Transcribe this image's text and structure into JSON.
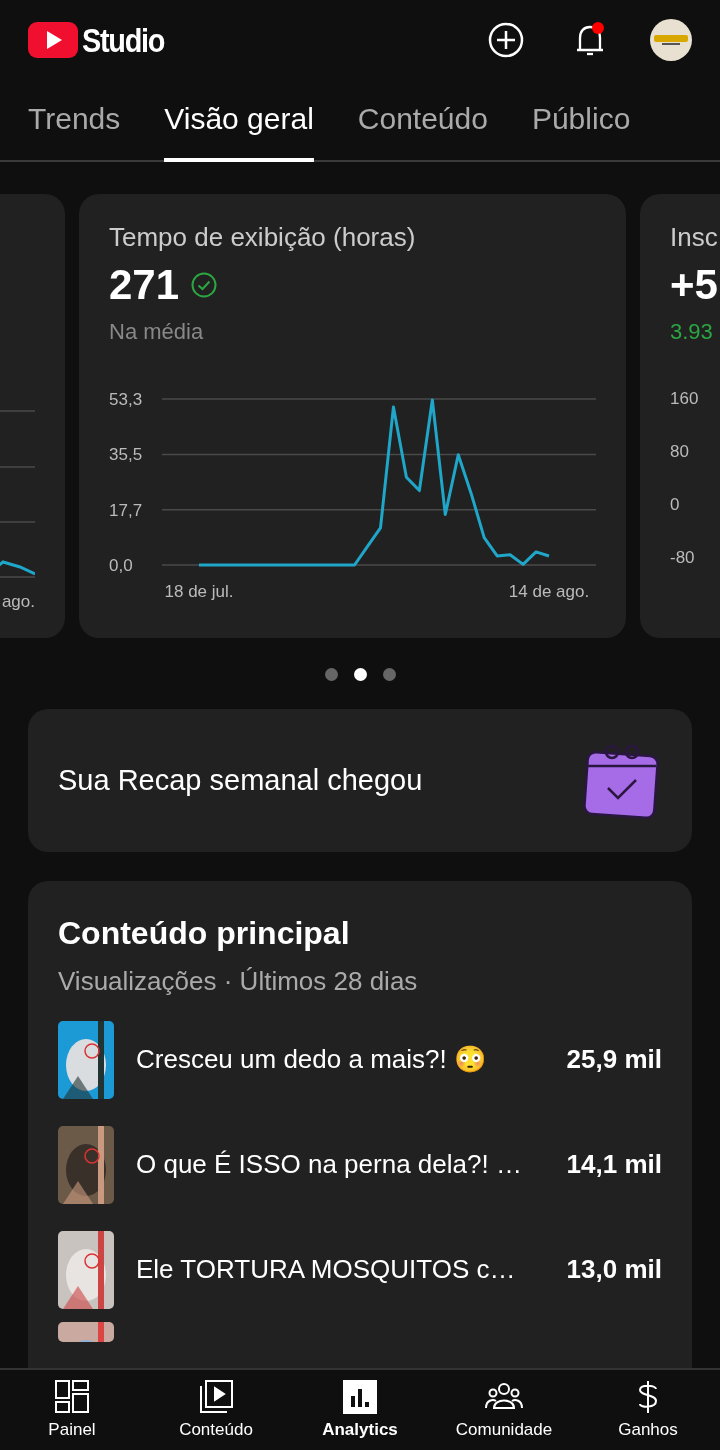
{
  "header": {
    "logo_text": "Studio",
    "notification_badge": true
  },
  "tabs": [
    {
      "label": "Trends",
      "selected": false
    },
    {
      "label": "Visão geral",
      "selected": true
    },
    {
      "label": "Conteúdo",
      "selected": false
    },
    {
      "label": "Público",
      "selected": false
    }
  ],
  "cards": {
    "previous": {
      "x_label": "ago."
    },
    "current": {
      "title": "Tempo de exibição (horas)",
      "value": "271",
      "status": "Na média",
      "chart_data": {
        "type": "line",
        "categories": [
          "18 de jul.",
          null,
          null,
          null,
          null,
          null,
          null,
          null,
          null,
          null,
          null,
          null,
          null,
          null,
          null,
          null,
          null,
          null,
          null,
          null,
          null,
          null,
          null,
          null,
          null,
          null,
          null,
          "14 de ago."
        ],
        "yticks": [
          {
            "value": 0,
            "label": "0,0"
          },
          {
            "value": 17.7,
            "label": "17,7"
          },
          {
            "value": 35.5,
            "label": "35,5"
          },
          {
            "value": 53.3,
            "label": "53,3"
          }
        ],
        "ylim": [
          0,
          53.3
        ],
        "series": [
          {
            "color": "#1fa6c9",
            "values": [
              0,
              0,
              0,
              0,
              0,
              0,
              0,
              0,
              0,
              0,
              0,
              0,
              0,
              6,
              11.9,
              50.7,
              28.2,
              23.9,
              53,
              16.2,
              35.4,
              22.9,
              8.8,
              2.9,
              3.3,
              0.2,
              4.2,
              2.9
            ]
          }
        ]
      }
    },
    "next": {
      "title": "Insc",
      "value": "+5",
      "change": "3.93",
      "y_labels": [
        "160",
        "80",
        "0",
        "-80"
      ]
    }
  },
  "pager": [
    {
      "selected": false
    },
    {
      "selected": true
    },
    {
      "selected": false
    }
  ],
  "recap": {
    "title": "Sua Recap semanal chegou"
  },
  "top_content": {
    "title": "Conteúdo principal",
    "subtitle": "Visualizações · Últimos 28 dias",
    "items": [
      {
        "title": "Cresceu um dedo a mais?! 😳",
        "views": "25,9 mil"
      },
      {
        "title": "O que É ISSO na perna dela?! …",
        "views": "14,1 mil"
      },
      {
        "title": "Ele TORTURA MOSQUITOS c…",
        "views": "13,0 mil"
      }
    ]
  },
  "bottom_nav": [
    {
      "label": "Painel",
      "selected": false
    },
    {
      "label": "Conteúdo",
      "selected": false
    },
    {
      "label": "Analytics",
      "selected": true
    },
    {
      "label": "Comunidade",
      "selected": false
    },
    {
      "label": "Ganhos",
      "selected": false
    }
  ]
}
